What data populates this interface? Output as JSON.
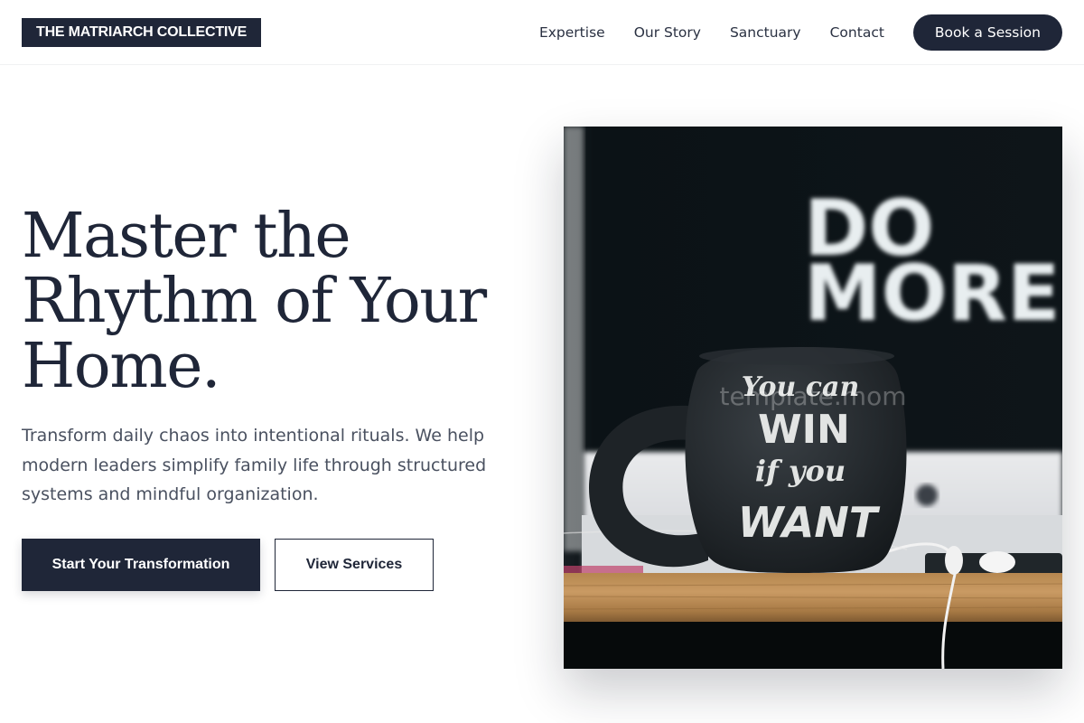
{
  "brand": {
    "logo_text": "THE MATRIARCH COLLECTIVE"
  },
  "nav": {
    "links": [
      "Expertise",
      "Our Story",
      "Sanctuary",
      "Contact"
    ],
    "cta_label": "Book a Session"
  },
  "hero": {
    "title_line1": "Master the",
    "title_line2": "Rhythm of Your",
    "title_line3": "Home.",
    "subtitle": "Transform daily chaos into intentional rituals. We help modern leaders simplify family life through structured systems and mindful organization.",
    "primary_button": "Start Your Transformation",
    "secondary_button": "View Services"
  },
  "image": {
    "sign_line1": "DO",
    "sign_line2": "MORE.",
    "mug_line1": "You can",
    "mug_line2": "WIN",
    "mug_line3": "if you",
    "mug_line4": "WANT",
    "watermark": "template.mom"
  },
  "colors": {
    "navy": "#1f2638",
    "text_muted": "#4a5160",
    "white": "#ffffff"
  }
}
